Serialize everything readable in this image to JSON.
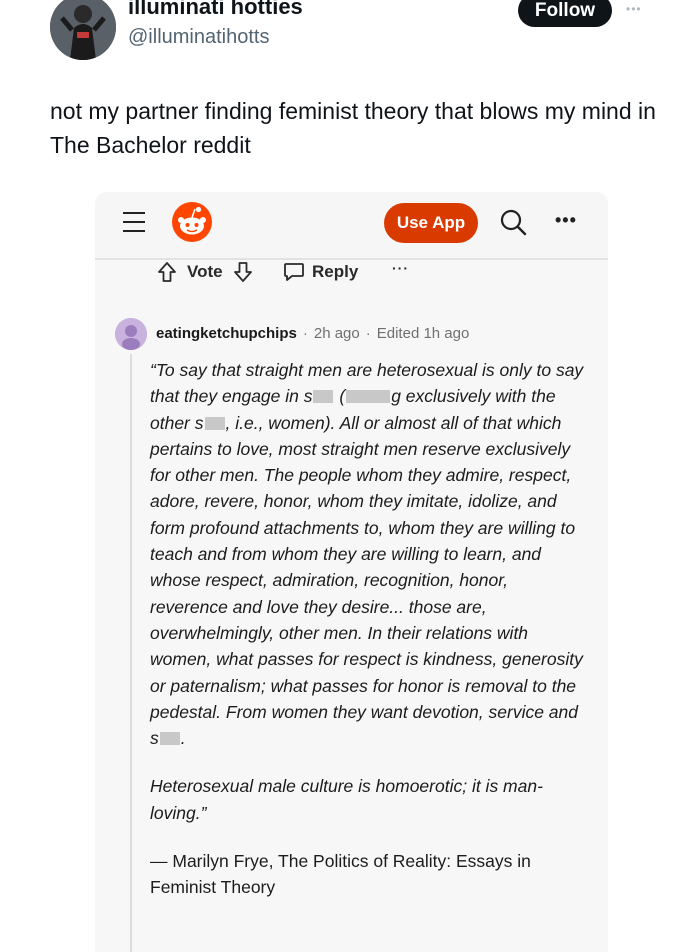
{
  "tweet": {
    "display_name": "illuminati hotties",
    "handle": "@illuminatihotts",
    "follow_label": "Follow",
    "more_icon": "ellipsis-icon",
    "text": "not my partner finding feminist theory that blows my mind in The Bachelor reddit"
  },
  "reddit": {
    "topbar": {
      "menu_icon": "hamburger-icon",
      "logo_icon": "reddit-snoo-icon",
      "use_app_label": "Use App",
      "search_icon": "search-icon",
      "more_icon": "ellipsis-icon",
      "accent_color": "#d93a00"
    },
    "actions": {
      "vote_label": "Vote",
      "reply_label": "Reply",
      "more_label": "···"
    },
    "comment": {
      "username": "eatingketchupchips",
      "separator": "·",
      "time": "2h ago",
      "edited": "Edited 1h ago",
      "p1_a": "“To say that straight men are heterosexual is only to say that they engage in s",
      "p1_b": " (",
      "p1_c": "g exclusively with the other s",
      "p1_d": ", i.e., women). All or almost all of that which pertains to love, most straight men reserve exclusively for other men. The people whom they admire, respect, adore, revere, honor, whom they imitate, idolize, and form profound attachments to, whom they are willing to teach and from whom they are willing to learn, and whose respect, admiration, recognition, honor, reverence and love they desire... those are, overwhelmingly, other men. In their relations with women, what passes for respect is kindness, generosity or paternalism; what passes for honor is removal to the pedestal. From women they want devotion, service and s",
      "p1_e": ".",
      "p2": "Heterosexual male culture is homoerotic; it is man-loving.”",
      "attribution": "— Marilyn Frye, The Politics of Reality: Essays in Feminist Theory"
    }
  }
}
